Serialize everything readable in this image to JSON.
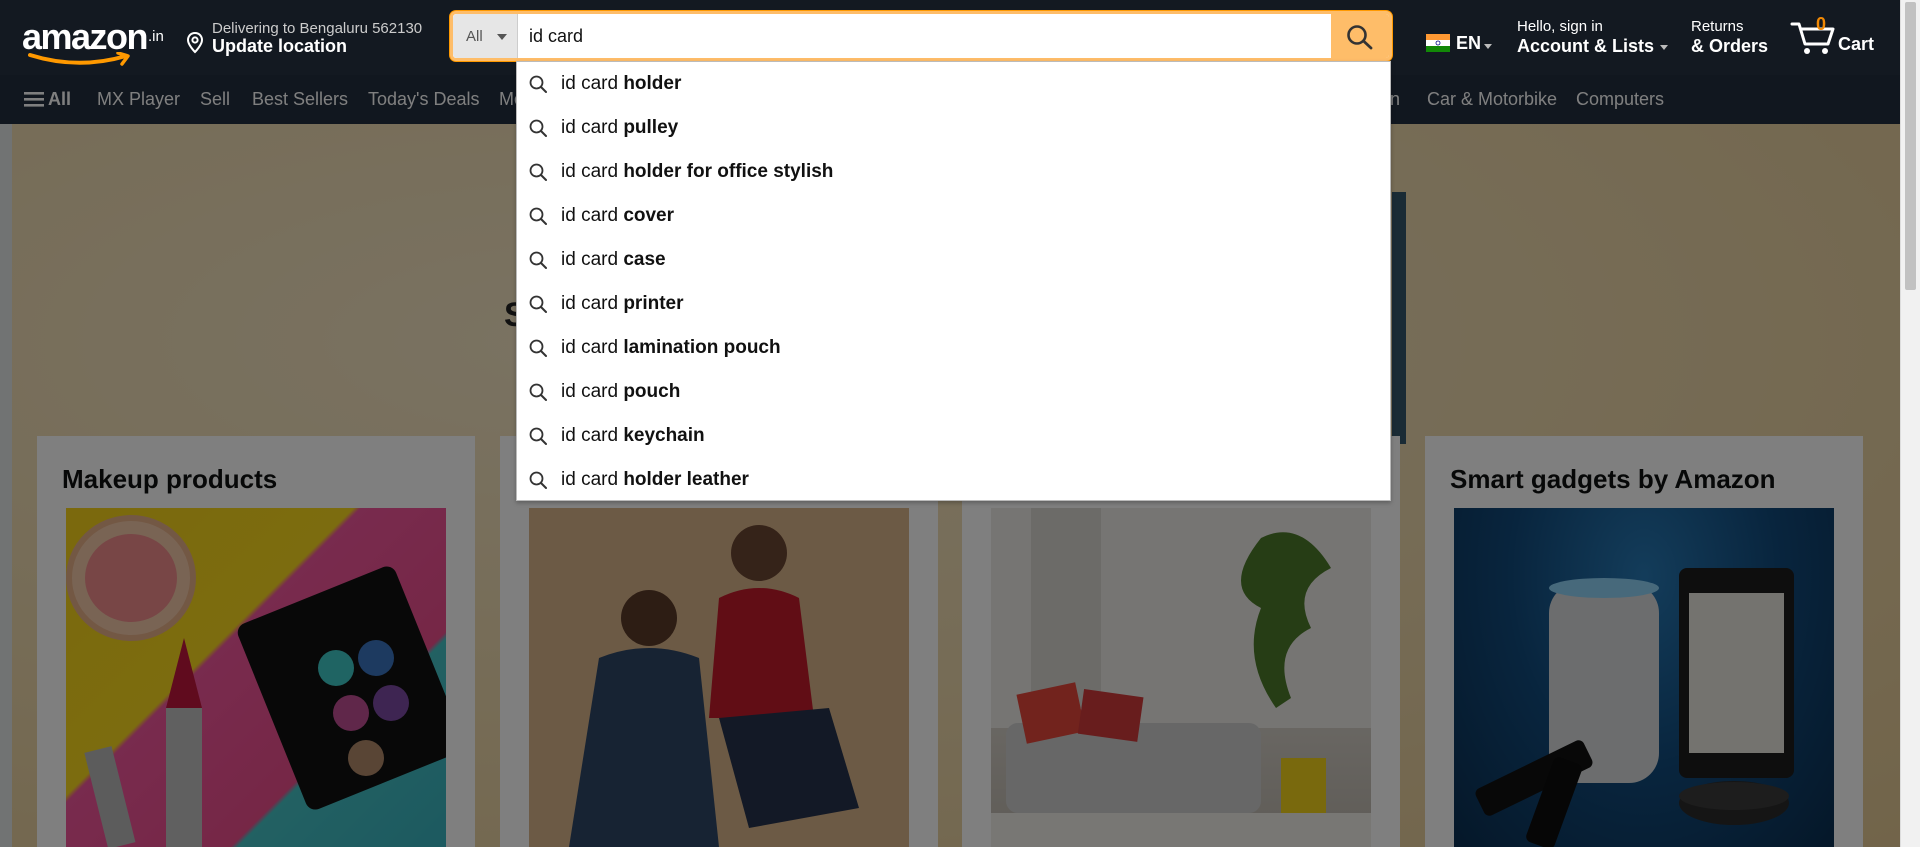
{
  "header": {
    "logo_text": "amazon",
    "logo_tld": ".in",
    "delivery_line1": "Delivering to Bengaluru 562130",
    "delivery_line2": "Update location",
    "search_category": "All",
    "search_value": "id card",
    "language": "EN",
    "account_line1": "Hello, sign in",
    "account_line2": "Account & Lists",
    "orders_line1": "Returns",
    "orders_line2": "& Orders",
    "cart_count": "0",
    "cart_label": "Cart"
  },
  "nav": {
    "all_label": "All",
    "items": [
      "MX Player",
      "Sell",
      "Best Sellers",
      "Today's Deals",
      "Mo",
      "on",
      "Car & Motorbike",
      "Computers"
    ]
  },
  "hero": {
    "peek_letter": "S"
  },
  "cards": [
    {
      "title": "Makeup products"
    },
    {
      "title": ""
    },
    {
      "title": ""
    },
    {
      "title": "Smart gadgets by Amazon"
    }
  ],
  "suggestions": [
    {
      "prefix": "id card ",
      "completion": "holder"
    },
    {
      "prefix": "id card ",
      "completion": "pulley"
    },
    {
      "prefix": "id card ",
      "completion": "holder for office stylish"
    },
    {
      "prefix": "id card ",
      "completion": "cover"
    },
    {
      "prefix": "id card ",
      "completion": "case"
    },
    {
      "prefix": "id card ",
      "completion": "printer"
    },
    {
      "prefix": "id card ",
      "completion": "lamination pouch"
    },
    {
      "prefix": "id card ",
      "completion": "pouch"
    },
    {
      "prefix": "id card ",
      "completion": "keychain"
    },
    {
      "prefix": "id card ",
      "completion": "holder leather"
    }
  ],
  "colors": {
    "nav_belt": "#131921",
    "nav_main": "#232f3e",
    "search_button": "#febd69",
    "cart_count": "#f08804"
  }
}
